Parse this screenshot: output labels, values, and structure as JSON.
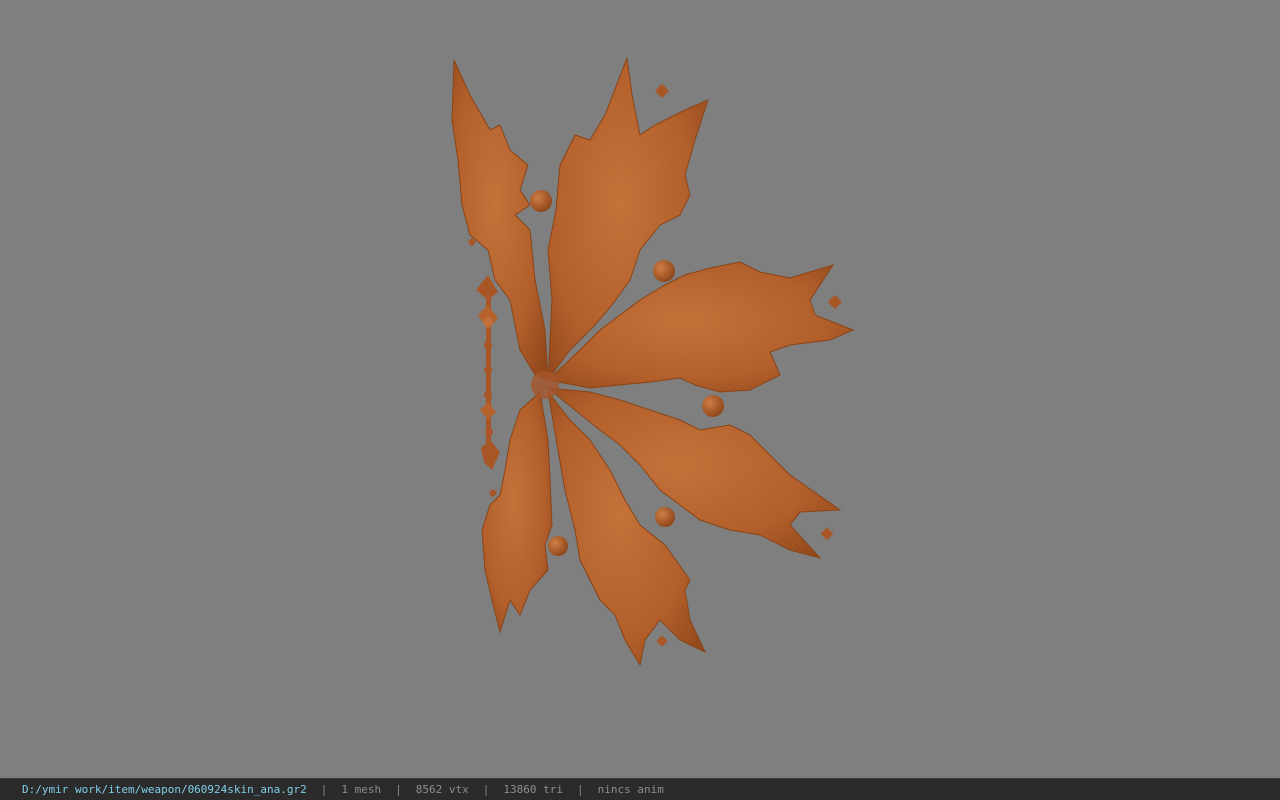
{
  "viewport": {
    "model_name": "060924skin_ana",
    "model_color": "#b5622c",
    "background_color": "#7f7f7f"
  },
  "statusbar": {
    "file_path": "D:/ymir work/item/weapon/060924skin_ana.gr2",
    "separator": "|",
    "mesh_count": "1 mesh",
    "vertex_count": "8562 vtx",
    "triangle_count": "13860 tri",
    "anim_status": "nincs anim"
  }
}
